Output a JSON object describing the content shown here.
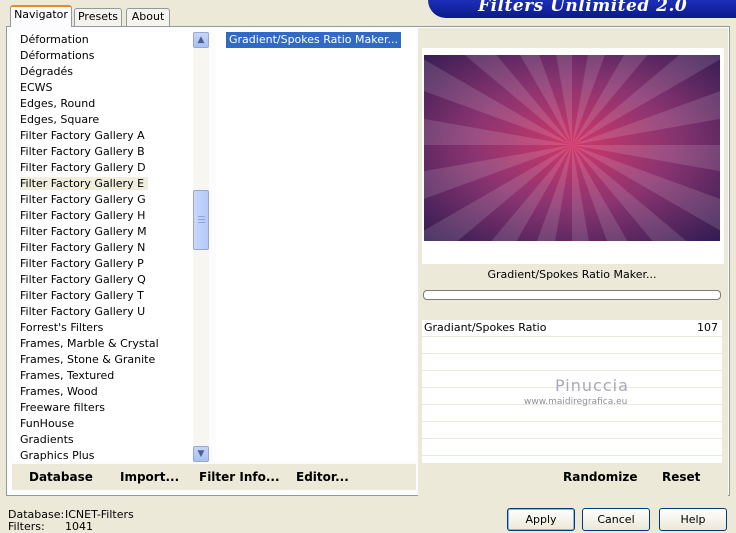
{
  "tabs": [
    "Navigator",
    "Presets",
    "About"
  ],
  "banner_title": "Filters Unlimited 2.0",
  "categories": [
    "Déformation",
    "Déformations",
    "Dégradés",
    "ECWS",
    "Edges, Round",
    "Edges, Square",
    "Filter Factory Gallery A",
    "Filter Factory Gallery B",
    "Filter Factory Gallery D",
    "Filter Factory Gallery E",
    "Filter Factory Gallery G",
    "Filter Factory Gallery H",
    "Filter Factory Gallery M",
    "Filter Factory Gallery N",
    "Filter Factory Gallery P",
    "Filter Factory Gallery Q",
    "Filter Factory Gallery T",
    "Filter Factory Gallery U",
    "Forrest's Filters",
    "Frames, Marble & Crystal",
    "Frames, Stone & Granite",
    "Frames, Textured",
    "Frames, Wood",
    "Freeware filters",
    "FunHouse",
    "Gradients",
    "Graphics Plus"
  ],
  "selected_category": "Filter Factory Gallery E",
  "filters": [
    "Gradient/Spokes Ratio Maker..."
  ],
  "preview": {
    "filter_name": "Gradient/Spokes Ratio Maker...",
    "colors": {
      "center": "#d0386a",
      "mid": "#8a3470",
      "edge": "#2a1a50"
    }
  },
  "parameters": [
    {
      "name": "Gradiant/Spokes Ratio",
      "value": "107"
    }
  ],
  "watermark": {
    "name": "Pinuccia",
    "url": "www.maidiregrafica.eu"
  },
  "left_buttons": {
    "database": "Database",
    "import": "Import...",
    "filter_info": "Filter Info...",
    "editor": "Editor..."
  },
  "right_buttons": {
    "randomize": "Randomize",
    "reset": "Reset"
  },
  "info": {
    "database_label": "Database:",
    "database_value": "ICNET-Filters",
    "filters_label": "Filters:",
    "filters_value": "1041"
  },
  "dialog_buttons": {
    "apply": "Apply",
    "cancel": "Cancel",
    "help": "Help"
  }
}
